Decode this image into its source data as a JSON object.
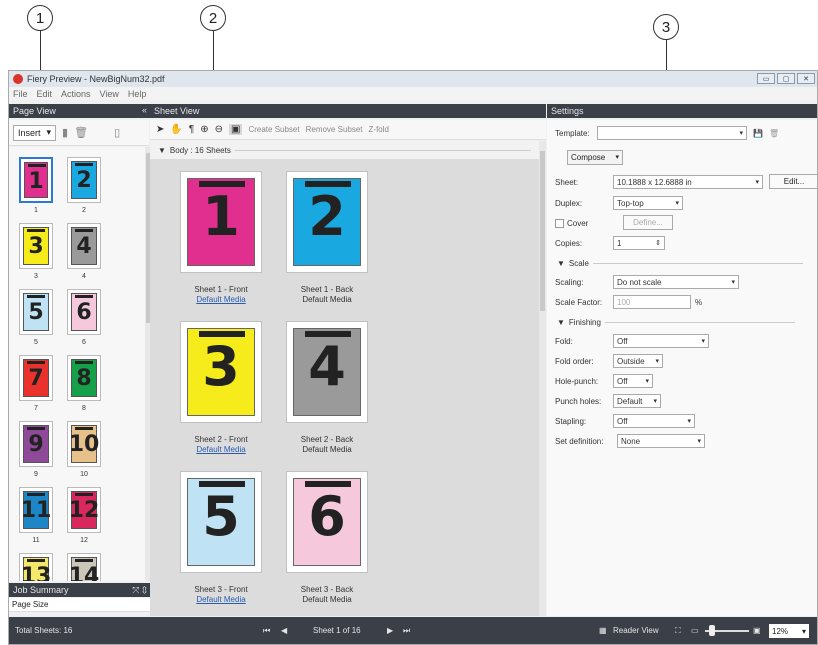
{
  "callouts": [
    "1",
    "2",
    "3"
  ],
  "window": {
    "title": "Fiery Preview - NewBigNum32.pdf",
    "min": "▭",
    "max": "▢",
    "close": "✕"
  },
  "menu": [
    "File",
    "Edit",
    "Actions",
    "View",
    "Help"
  ],
  "page_view": {
    "title": "Page View",
    "collapse": "«",
    "insert_label": "Insert",
    "pages": [
      {
        "num": "1",
        "color": "#e02f8f"
      },
      {
        "num": "2",
        "color": "#19a8e0"
      },
      {
        "num": "3",
        "color": "#f6ec1b"
      },
      {
        "num": "4",
        "color": "#9a9a9a"
      },
      {
        "num": "5",
        "color": "#bfe3f4"
      },
      {
        "num": "6",
        "color": "#f5c8dc"
      },
      {
        "num": "7",
        "color": "#e8322b"
      },
      {
        "num": "8",
        "color": "#16a04a"
      },
      {
        "num": "9",
        "color": "#8e4a98"
      },
      {
        "num": "10",
        "color": "#e6c28a"
      },
      {
        "num": "11",
        "color": "#1c86c7"
      },
      {
        "num": "12",
        "color": "#d8285d"
      },
      {
        "num": "13",
        "color": "#f3e86a"
      },
      {
        "num": "14",
        "color": "#cbc6b8"
      }
    ],
    "labels": [
      "1",
      "2",
      "3",
      "4",
      "5",
      "6",
      "7",
      "8",
      "9",
      "10",
      "11",
      "12"
    ]
  },
  "job_summary": {
    "title": "Job Summary",
    "row": "Page Size"
  },
  "sheet_view": {
    "title": "Sheet View",
    "create_subset": "Create Subset",
    "remove_subset": "Remove Subset",
    "zfold": "Z-fold",
    "body_header": "Body : 16 Sheets",
    "sheets": [
      {
        "num": "1",
        "color": "#e02f8f",
        "label": "Sheet 1 - Front",
        "media": "Default Media",
        "link": true
      },
      {
        "num": "2",
        "color": "#19a8e0",
        "label": "Sheet 1 - Back",
        "media": "Default Media",
        "link": false
      },
      {
        "num": "3",
        "color": "#f6ec1b",
        "label": "Sheet 2 - Front",
        "media": "Default Media",
        "link": true
      },
      {
        "num": "4",
        "color": "#9a9a9a",
        "label": "Sheet 2 - Back",
        "media": "Default Media",
        "link": false
      },
      {
        "num": "5",
        "color": "#bfe3f4",
        "label": "Sheet 3 - Front",
        "media": "Default Media",
        "link": true
      },
      {
        "num": "6",
        "color": "#f5c8dc",
        "label": "Sheet 3 - Back",
        "media": "Default Media",
        "link": false
      }
    ]
  },
  "settings": {
    "title": "Settings",
    "template_label": "Template:",
    "template_value": "",
    "compose": "Compose",
    "sheet_label": "Sheet:",
    "sheet_value": "10.1888 x 12.6888 in",
    "edit_btn": "Edit...",
    "duplex_label": "Duplex:",
    "duplex_value": "Top-top",
    "cover_label": "Cover",
    "define_btn": "Define...",
    "copies_label": "Copies:",
    "copies_value": "1",
    "scale_section": "Scale",
    "scaling_label": "Scaling:",
    "scaling_value": "Do not scale",
    "scale_factor_label": "Scale Factor:",
    "scale_factor_value": "100",
    "percent": "%",
    "finishing_section": "Finishing",
    "fold_label": "Fold:",
    "fold_value": "Off",
    "fold_order_label": "Fold order:",
    "fold_order_value": "Outside",
    "hole_punch_label": "Hole-punch:",
    "hole_punch_value": "Off",
    "punch_holes_label": "Punch holes:",
    "punch_holes_value": "Default",
    "stapling_label": "Stapling:",
    "stapling_value": "Off",
    "set_def_label": "Set definition:",
    "set_def_value": "None"
  },
  "status": {
    "total_sheets": "Total Sheets: 16",
    "sheet_of": "Sheet 1 of 16",
    "reader_view": "Reader View",
    "zoom": "12%"
  }
}
